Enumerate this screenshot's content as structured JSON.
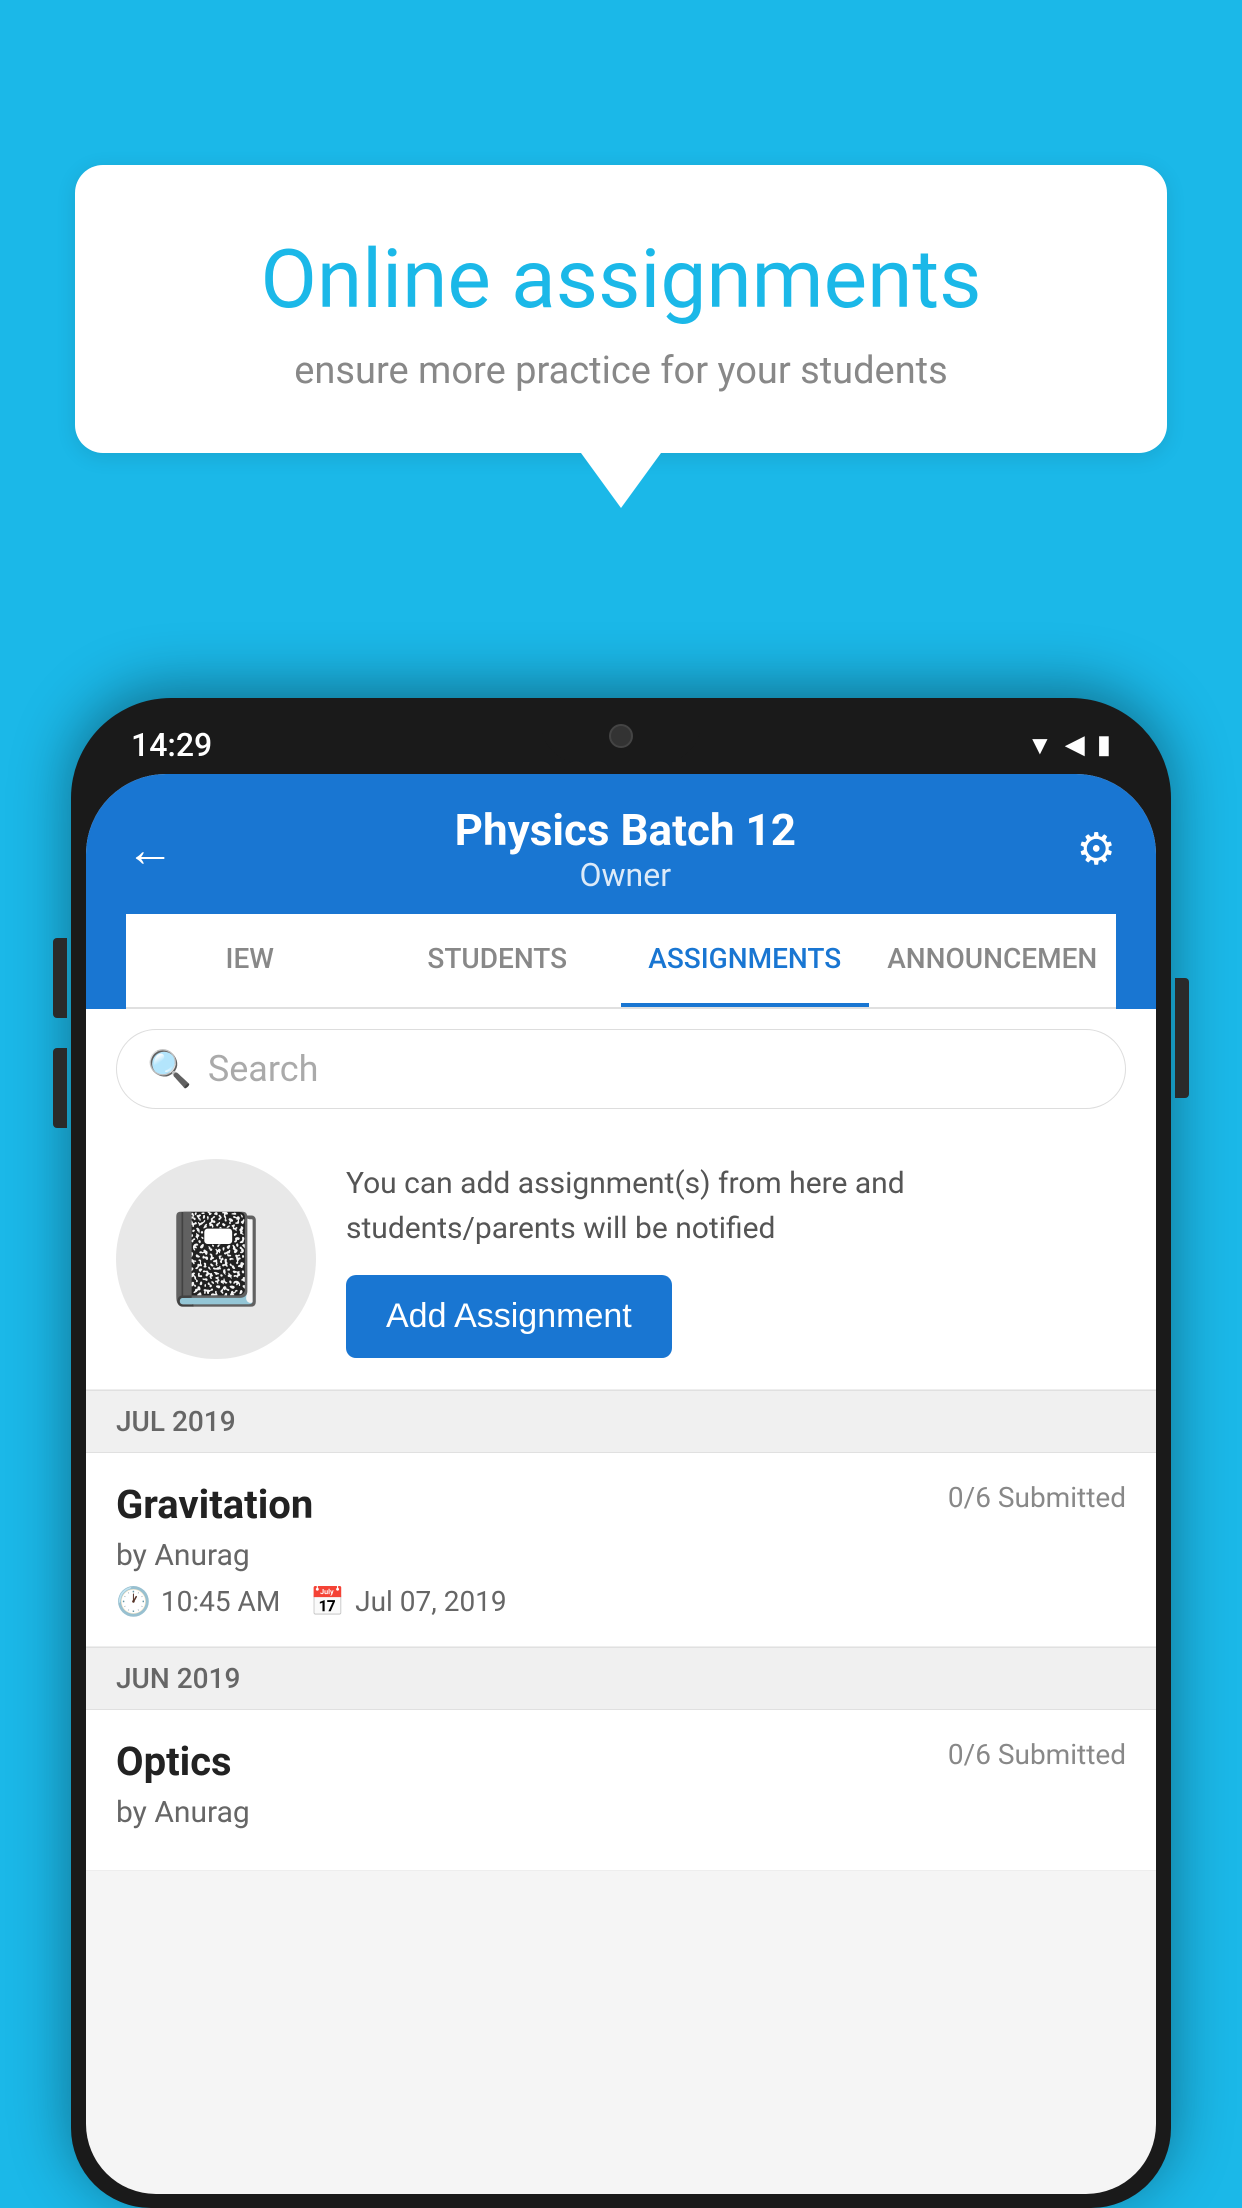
{
  "background": {
    "color": "#1BB8E8"
  },
  "speech_bubble": {
    "title": "Online assignments",
    "subtitle": "ensure more practice for your students"
  },
  "phone": {
    "time": "14:29",
    "header": {
      "title": "Physics Batch 12",
      "subtitle": "Owner",
      "back_label": "←",
      "settings_label": "⚙"
    },
    "tabs": [
      {
        "label": "IEW",
        "active": false
      },
      {
        "label": "STUDENTS",
        "active": false
      },
      {
        "label": "ASSIGNMENTS",
        "active": true
      },
      {
        "label": "ANNOUNCEMEN",
        "active": false
      }
    ],
    "search": {
      "placeholder": "Search"
    },
    "promo": {
      "description": "You can add assignment(s) from here and students/parents will be notified",
      "button_label": "Add Assignment"
    },
    "sections": [
      {
        "month_label": "JUL 2019",
        "assignments": [
          {
            "title": "Gravitation",
            "submitted": "0/6 Submitted",
            "author": "by Anurag",
            "time": "10:45 AM",
            "date": "Jul 07, 2019"
          }
        ]
      },
      {
        "month_label": "JUN 2019",
        "assignments": [
          {
            "title": "Optics",
            "submitted": "0/6 Submitted",
            "author": "by Anurag",
            "time": "",
            "date": ""
          }
        ]
      }
    ]
  }
}
